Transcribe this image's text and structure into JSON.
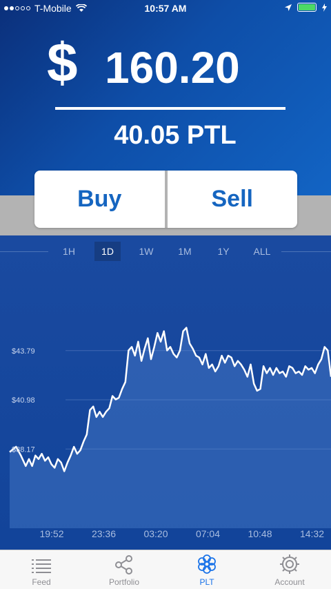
{
  "status": {
    "carrier": "T-Mobile",
    "time": "10:57 AM"
  },
  "price": {
    "symbol": "$",
    "usd": "160.20",
    "ptl": "40.05 PTL"
  },
  "actions": {
    "buy": "Buy",
    "sell": "Sell"
  },
  "ranges": [
    {
      "label": "1H",
      "active": false
    },
    {
      "label": "1D",
      "active": true
    },
    {
      "label": "1W",
      "active": false
    },
    {
      "label": "1M",
      "active": false
    },
    {
      "label": "1Y",
      "active": false
    },
    {
      "label": "ALL",
      "active": false
    }
  ],
  "chart_data": {
    "type": "line",
    "y_tick_labels": [
      "$43.79",
      "$40.98",
      "$38.17"
    ],
    "x_tick_labels": [
      "19:52",
      "23:36",
      "03:20",
      "07:04",
      "10:48",
      "14:32"
    ],
    "y_ticks": [
      43.79,
      40.98,
      38.17
    ],
    "ylim": [
      34.2,
      48.0
    ],
    "xlim": [
      0,
      100
    ],
    "series": [
      {
        "x": [
          0,
          2,
          3.5,
          5,
          6,
          7,
          8,
          9,
          10,
          11,
          12,
          13,
          14,
          15,
          16,
          17,
          18,
          19,
          20,
          21,
          22,
          23,
          24,
          25,
          26,
          27,
          28,
          29,
          30,
          31,
          32,
          33,
          34,
          35,
          36,
          37,
          38,
          39,
          40,
          41,
          42,
          43,
          44,
          45,
          46,
          47,
          48,
          49,
          50,
          51,
          52,
          53,
          54,
          55,
          56,
          57,
          58,
          59,
          60,
          61,
          62,
          63,
          64,
          65,
          66,
          67,
          68,
          69,
          70,
          71,
          72,
          73,
          74,
          75,
          76,
          77,
          78,
          79,
          80,
          81,
          82,
          83,
          84,
          85,
          86,
          87,
          88,
          89,
          90,
          91,
          92,
          93,
          94,
          95,
          96,
          97,
          98,
          99,
          100
        ],
        "values": [
          38.0,
          38.3,
          37.8,
          37.2,
          37.6,
          37.2,
          37.8,
          37.6,
          37.9,
          37.5,
          37.7,
          37.3,
          37.1,
          37.6,
          37.4,
          36.9,
          37.4,
          37.8,
          38.3,
          37.9,
          38.1,
          38.6,
          39.0,
          40.4,
          40.6,
          40.0,
          40.3,
          40.0,
          40.3,
          40.5,
          41.2,
          41.0,
          41.1,
          41.6,
          42.0,
          43.8,
          44.0,
          43.5,
          44.3,
          43.2,
          43.9,
          44.5,
          43.3,
          44.0,
          44.8,
          44.3,
          44.9,
          43.8,
          44.0,
          43.6,
          43.4,
          43.8,
          44.9,
          45.1,
          44.2,
          43.9,
          43.5,
          43.4,
          43.0,
          43.6,
          42.8,
          43.0,
          42.6,
          42.9,
          43.5,
          43.1,
          43.5,
          43.4,
          42.9,
          43.2,
          43.0,
          42.7,
          42.3,
          43.0,
          41.9,
          41.5,
          41.6,
          42.9,
          42.5,
          42.8,
          42.4,
          42.8,
          42.5,
          42.6,
          42.3,
          42.9,
          42.8,
          42.5,
          42.6,
          42.4,
          42.9,
          42.7,
          42.8,
          42.5,
          43.0,
          43.3,
          44.0,
          43.8,
          42.3
        ]
      }
    ]
  },
  "tabs": [
    {
      "label": "Feed",
      "icon": "list-icon",
      "active": false
    },
    {
      "label": "Portfolio",
      "icon": "share-icon",
      "active": false
    },
    {
      "label": "PLT",
      "icon": "plt-logo-icon",
      "active": true
    },
    {
      "label": "Account",
      "icon": "gear-icon",
      "active": false
    }
  ],
  "colors": {
    "accent": "#1565c0",
    "tab_active": "#1a73e8",
    "chart_bg": "#12449a"
  }
}
